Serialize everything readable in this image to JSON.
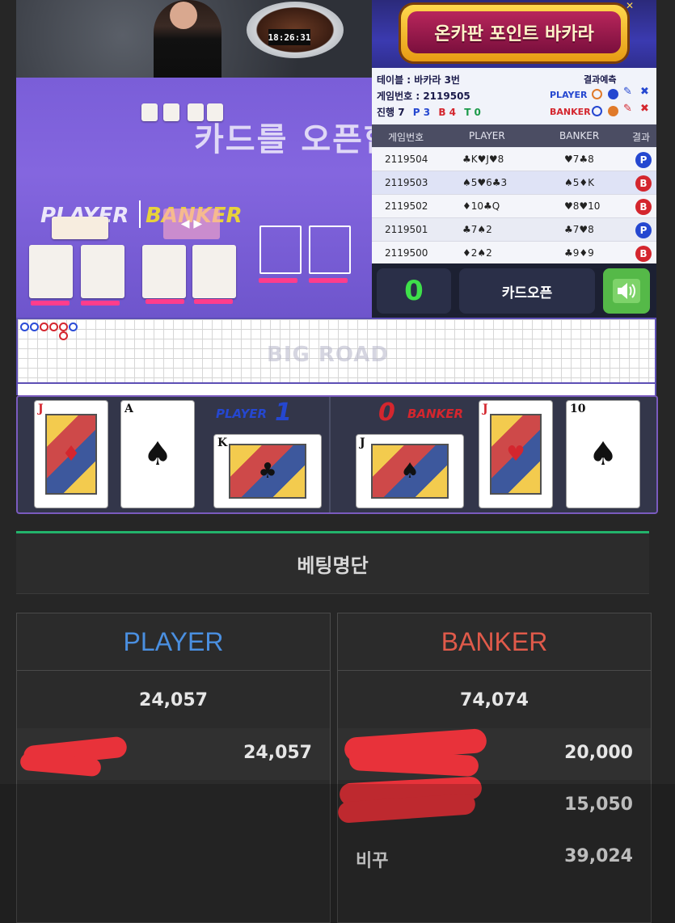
{
  "video": {
    "clock": "18:26:31",
    "overlay_message": "카드를 오픈합니다.",
    "player_label": "PLAYER",
    "banker_label": "BANKER",
    "shoe_button": "◀ ▶"
  },
  "panel": {
    "banner_title": "온카판 포인트 바카라",
    "table_label": "테이블 : 바카라 3번",
    "game_no_label": "게임번호 : 2119505",
    "progress_label": "진행 7",
    "progress_p": "P 3",
    "progress_b": "B 4",
    "progress_t": "T 0",
    "predict_label": "결과예측",
    "predict_player": "PLAYER",
    "predict_banker": "BANKER",
    "history_headers": {
      "game_no": "게임번호",
      "player": "PLAYER",
      "banker": "BANKER",
      "result": "결과"
    },
    "history": [
      {
        "no": "2119504",
        "player": "♣K♥J♥8",
        "banker": "♥7♣8",
        "result": "P",
        "color": "#2547d0"
      },
      {
        "no": "2119503",
        "player": "♠5♥6♣3",
        "banker": "♠5♦K",
        "result": "B",
        "color": "#d4262e"
      },
      {
        "no": "2119502",
        "player": "♦10♣Q",
        "banker": "♥8♥10",
        "result": "B",
        "color": "#d4262e"
      },
      {
        "no": "2119501",
        "player": "♣7♠2",
        "banker": "♣7♥8",
        "result": "P",
        "color": "#2547d0"
      },
      {
        "no": "2119500",
        "player": "♦2♠2",
        "banker": "♣9♦9",
        "result": "B",
        "color": "#d4262e"
      }
    ],
    "countdown": "0",
    "open_button": "카드오픈",
    "sound_icon": "speaker-icon"
  },
  "bigroad": {
    "title": "BIG ROAD"
  },
  "reveal": {
    "player_title": "PLAYER",
    "player_score": "1",
    "banker_title": "BANKER",
    "banker_score": "0",
    "player_cards": [
      {
        "rank": "J",
        "suit": "♦",
        "color": "#d4262e"
      },
      {
        "rank": "A",
        "suit": "♠",
        "color": "#111111"
      },
      {
        "rank": "K",
        "suit": "♣",
        "color": "#111111"
      }
    ],
    "banker_cards": [
      {
        "rank": "J",
        "suit": "♠",
        "color": "#111111"
      },
      {
        "rank": "J",
        "suit": "♥",
        "color": "#d4262e"
      },
      {
        "rank": "10",
        "suit": "♠",
        "color": "#111111"
      }
    ]
  },
  "betting": {
    "title": "베팅명단",
    "player": {
      "header": "PLAYER",
      "color": "#4a8fe0",
      "total": "24,057",
      "rows": [
        {
          "name": "",
          "amount": "24,057"
        }
      ]
    },
    "banker": {
      "header": "BANKER",
      "color": "#e05a4a",
      "total": "74,074",
      "rows": [
        {
          "name": "",
          "amount": "20,000"
        },
        {
          "name": "",
          "amount": "15,050"
        },
        {
          "name": "비꾸",
          "amount": "39,024"
        }
      ]
    }
  }
}
